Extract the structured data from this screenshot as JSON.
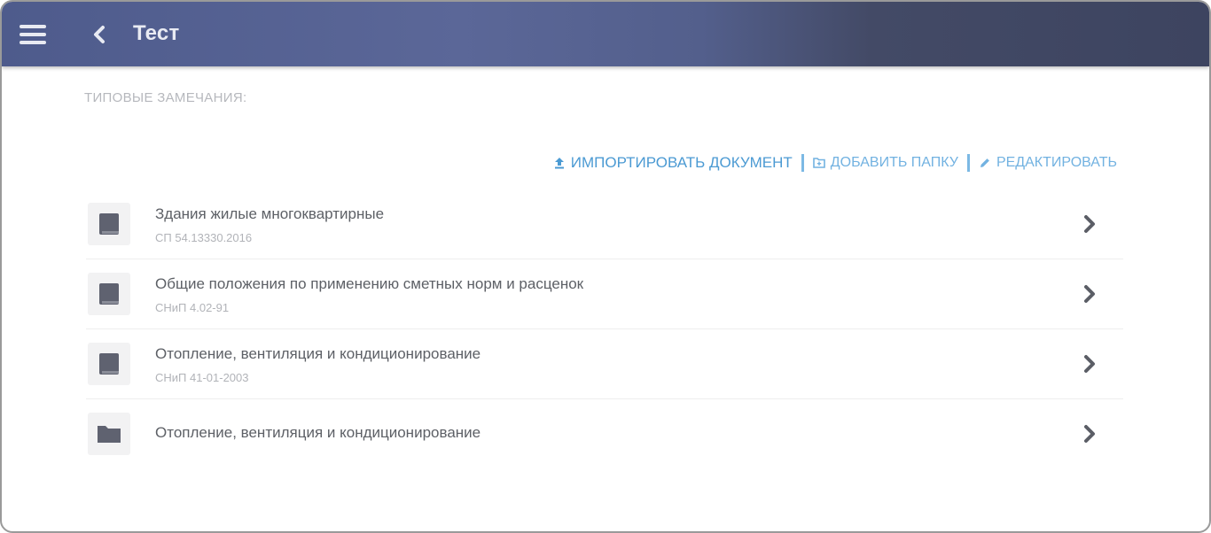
{
  "appbar": {
    "title": "Тест",
    "menu_icon": "menu-icon",
    "back_icon": "chevron-left-icon"
  },
  "section": {
    "label": "ТИПОВЫЕ ЗАМЕЧАНИЯ:"
  },
  "actions": {
    "import_label": "ИМПОРТИРОВАТЬ ДОКУМЕНТ",
    "add_folder_label": "ДОБАВИТЬ ПАПКУ",
    "edit_label": "РЕДАКТИРОВАТЬ"
  },
  "items": [
    {
      "title": "Здания жилые многоквартирные",
      "subtitle": "СП 54.13330.2016",
      "icon": "book-icon"
    },
    {
      "title": "Общие положения по применению сметных норм и расценок",
      "subtitle": "СНиП 4.02-91",
      "icon": "book-icon"
    },
    {
      "title": "Отопление, вентиляция и кондиционирование",
      "subtitle": "СНиП 41-01-2003",
      "icon": "book-icon"
    },
    {
      "title": "Отопление, вентиляция и кондиционирование",
      "subtitle": "",
      "icon": "folder-icon"
    }
  ],
  "colors": {
    "appbar_start": "#4e5b8c",
    "appbar_end": "#3d4460",
    "accent": "#4b9ad3",
    "icon_fill": "#5f6270"
  }
}
